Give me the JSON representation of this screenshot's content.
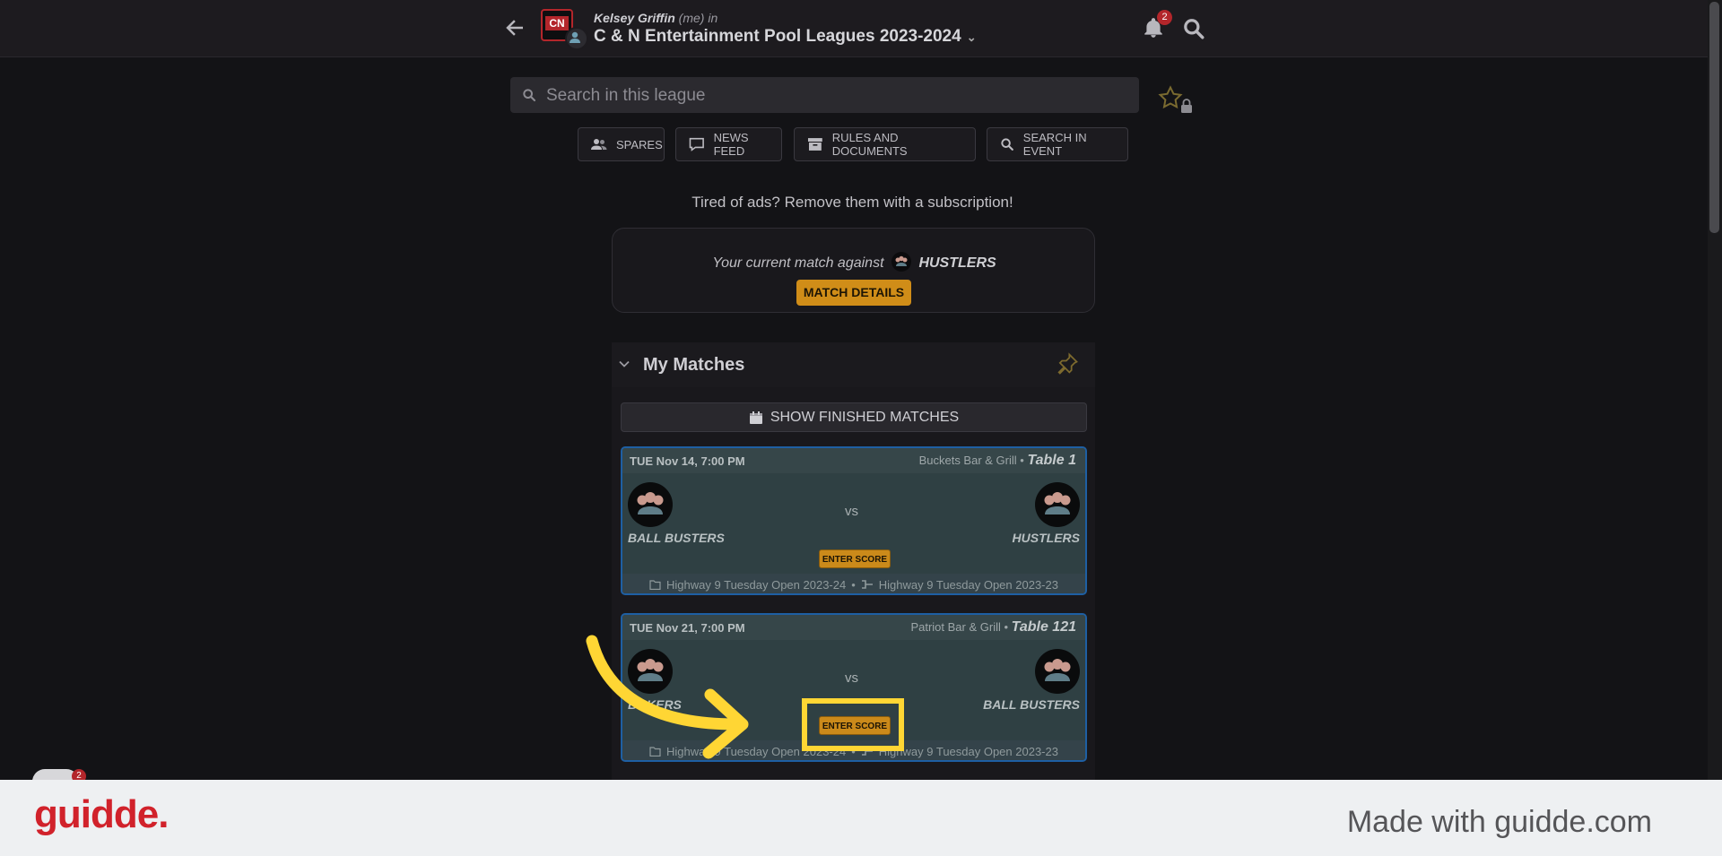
{
  "header": {
    "user_name": "Kelsey Griffin",
    "user_suffix": "(me) in",
    "league_name": "C & N Entertainment Pool Leagues 2023-2024",
    "logo_text": "CN",
    "notification_count": "2"
  },
  "search": {
    "placeholder": "Search in this league"
  },
  "toolbar": {
    "spares": "SPARES",
    "news_feed": "NEWS FEED",
    "rules": "RULES AND DOCUMENTS",
    "search_event": "SEARCH IN EVENT"
  },
  "ads_text": "Tired of ads? Remove them with a subscription!",
  "current_match": {
    "text": "Your current match against",
    "opponent": "HUSTLERS",
    "button": "MATCH DETAILS"
  },
  "my_matches": {
    "title": "My Matches",
    "show_finished": "SHOW FINISHED MATCHES",
    "matches": [
      {
        "date": "TUE Nov 14, 7:00 PM",
        "venue": "Buckets Bar & Grill •",
        "table": "Table 1",
        "home": "BALL BUSTERS",
        "away": "HUSTLERS",
        "vs": "vs",
        "action": "ENTER SCORE",
        "division": "Highway 9 Tuesday Open 2023-24",
        "bracket": "Highway 9 Tuesday Open 2023-23",
        "separator": "•"
      },
      {
        "date": "TUE Nov 21, 7:00 PM",
        "venue": "Patriot Bar & Grill •",
        "table": "Table 121",
        "home": "BOKERS",
        "away": "BALL BUSTERS",
        "vs": "vs",
        "action": "ENTER SCORE",
        "division": "Highway 9 Tuesday Open 2023-24",
        "bracket": "Highway 9 Tuesday Open 2023-23",
        "separator": "•"
      }
    ]
  },
  "guidde_badge": "2",
  "footer": {
    "logo": "guidde.",
    "made_with": "Made with guidde.com"
  },
  "colors": {
    "accent": "#d08d18",
    "highlight": "#ffd634",
    "card_border": "#1e5fa3",
    "brand_red": "#d1222b"
  }
}
